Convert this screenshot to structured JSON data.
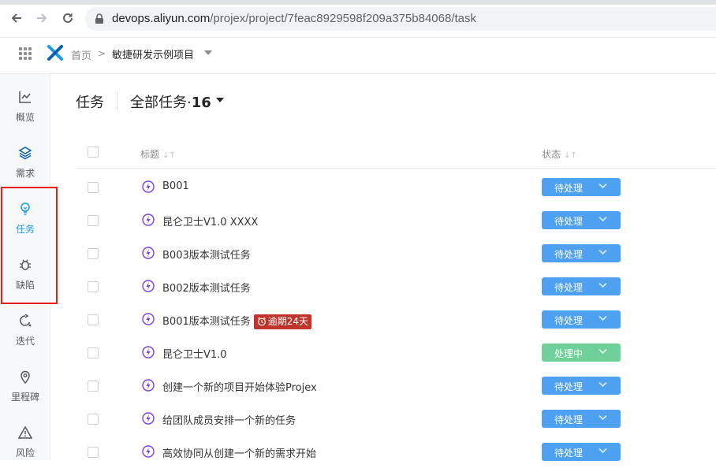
{
  "browser": {
    "url_host": "devops.aliyun.com",
    "url_path": "/projex/project/7feac8929598f209a375b84068/task"
  },
  "header": {
    "home": "首页",
    "separator": ">",
    "project": "敏捷研发示例项目"
  },
  "sidebar": {
    "items": [
      {
        "label": "概览",
        "icon": "chart-line-icon"
      },
      {
        "label": "需求",
        "icon": "layers-icon"
      },
      {
        "label": "任务",
        "icon": "lightbulb-icon"
      },
      {
        "label": "缺陷",
        "icon": "bug-icon"
      },
      {
        "label": "迭代",
        "icon": "cycle-icon"
      },
      {
        "label": "里程碑",
        "icon": "location-pin-icon"
      },
      {
        "label": "风险",
        "icon": "warning-icon"
      }
    ],
    "active": "任务"
  },
  "main": {
    "title": "任务",
    "view_name": "全部任务·",
    "view_count": "16",
    "columns": {
      "title": "标题",
      "status": "状态"
    },
    "sort_glyph": "↓↑"
  },
  "rows": [
    {
      "title": "B001",
      "status": "待处理",
      "status_color": "#4ea0f1"
    },
    {
      "title": "昆仑卫士V1.0 XXXX",
      "status": "待处理",
      "status_color": "#4ea0f1"
    },
    {
      "title": "B003版本测试任务",
      "status": "待处理",
      "status_color": "#4ea0f1"
    },
    {
      "title": "B002版本测试任务",
      "status": "待处理",
      "status_color": "#4ea0f1"
    },
    {
      "title": "B001版本测试任务",
      "badge": "逾期24天",
      "status": "待处理",
      "status_color": "#4ea0f1"
    },
    {
      "title": "昆仑卫士V1.0",
      "status": "处理中",
      "status_color": "#6fd09a"
    },
    {
      "title": "创建一个新的项目开始体验Projex",
      "status": "待处理",
      "status_color": "#4ea0f1"
    },
    {
      "title": "给团队成员安排一个新的任务",
      "status": "待处理",
      "status_color": "#4ea0f1"
    },
    {
      "title": "高效协同从创建一个新的需求开始",
      "status": "待处理",
      "status_color": "#4ea0f1"
    }
  ]
}
